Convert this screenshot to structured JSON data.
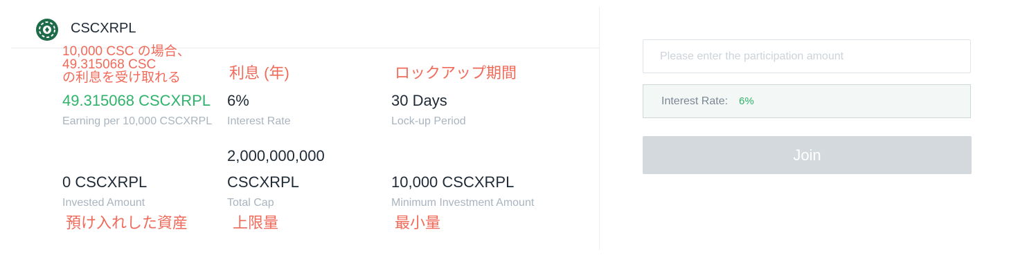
{
  "header": {
    "token_name": "CSCXRPL",
    "logo_icon": "poker-chip-icon"
  },
  "annotations": {
    "earning_note": [
      "10,000 CSC の場合、",
      "49.315068 CSC",
      "の利息を受け取れる"
    ],
    "interest_note": "利息 (年)",
    "lockup_note": "ロックアップ期間",
    "invested_note": "預け入れした資産",
    "total_cap_note": "上限量",
    "minimum_note": "最小量"
  },
  "stats": {
    "earning": {
      "value": "49.315068 CSCXRPL",
      "label": "Earning per 10,000 CSCXRPL"
    },
    "interest": {
      "value": "6%",
      "label": "Interest Rate"
    },
    "lockup": {
      "value": "30 Days",
      "label": "Lock-up Period"
    },
    "invested": {
      "value": "0 CSCXRPL",
      "label": "Invested Amount"
    },
    "total_cap": {
      "value_line1": "2,000,000,000",
      "value_line2": "CSCXRPL",
      "label": "Total Cap"
    },
    "minimum": {
      "value": "10,000 CSCXRPL",
      "label": "Minimum Investment Amount"
    }
  },
  "form": {
    "amount_placeholder": "Please enter the participation amount",
    "amount_value": "",
    "interest_label": "Interest Rate:",
    "interest_value": "6%",
    "join_label": "Join"
  },
  "colors": {
    "accent_green": "#2fb36b",
    "annotation_red": "#f06a5a",
    "join_disabled": "#d3d9dc",
    "logo_green": "#1e6b4a"
  }
}
